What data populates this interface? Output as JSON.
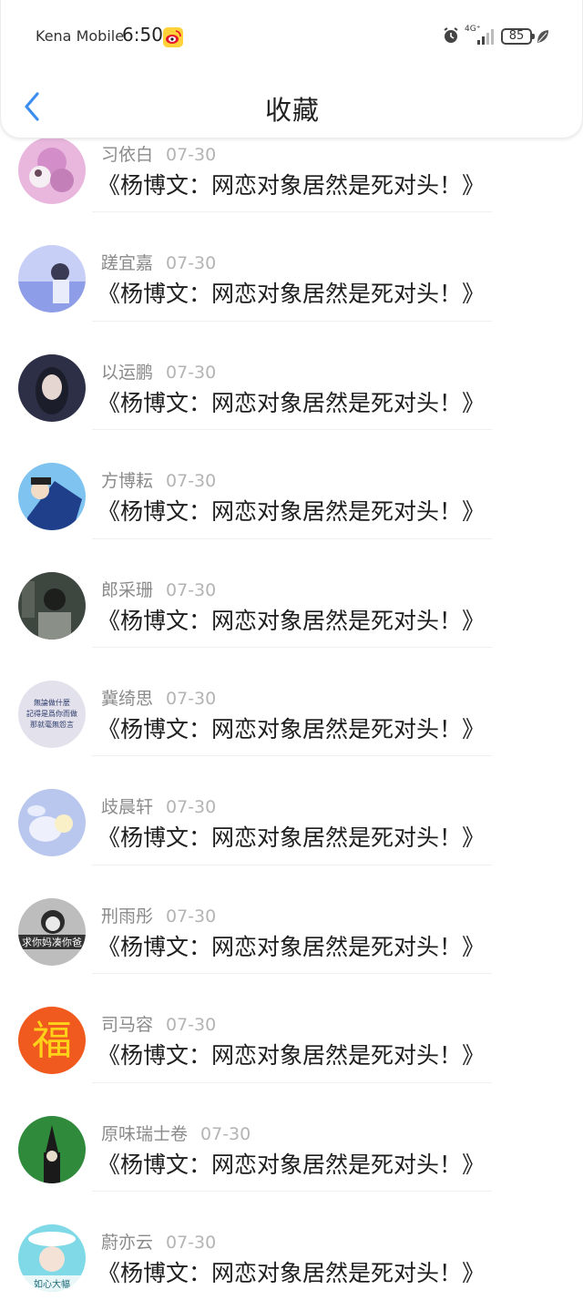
{
  "status_bar": {
    "carrier": "Kena Mobile",
    "time": "6:50",
    "network": "4G⁺",
    "battery": "85",
    "icons": [
      "weibo-icon",
      "alarm-icon",
      "signal-icon",
      "battery-icon",
      "leaf-icon"
    ]
  },
  "header": {
    "title": "收藏",
    "back_icon": "chevron-left-icon",
    "accent_color": "#3d8ef0"
  },
  "items": [
    {
      "name": "习依白",
      "date": "07-30",
      "title": "《杨博文：网恋对象居然是死对头！》"
    },
    {
      "name": "蹉宜嘉",
      "date": "07-30",
      "title": "《杨博文：网恋对象居然是死对头！》"
    },
    {
      "name": "以运鹏",
      "date": "07-30",
      "title": "《杨博文：网恋对象居然是死对头！》"
    },
    {
      "name": "方博耘",
      "date": "07-30",
      "title": "《杨博文：网恋对象居然是死对头！》"
    },
    {
      "name": "郎采珊",
      "date": "07-30",
      "title": "《杨博文：网恋对象居然是死对头！》"
    },
    {
      "name": "冀绮思",
      "date": "07-30",
      "title": "《杨博文：网恋对象居然是死对头！》",
      "avatar_text": [
        "無論做什麼",
        "記得是爲你而做",
        "那就毫無怨言"
      ]
    },
    {
      "name": "歧晨轩",
      "date": "07-30",
      "title": "《杨博文：网恋对象居然是死对头！》"
    },
    {
      "name": "刑雨彤",
      "date": "07-30",
      "title": "《杨博文：网恋对象居然是死对头！》",
      "avatar_text": [
        "求你妈凑你爸"
      ]
    },
    {
      "name": "司马容",
      "date": "07-30",
      "title": "《杨博文：网恋对象居然是死对头！》",
      "avatar_text": [
        "福"
      ]
    },
    {
      "name": "原味瑞士卷",
      "date": "07-30",
      "title": "《杨博文：网恋对象居然是死对头！》"
    },
    {
      "name": "蔚亦云",
      "date": "07-30",
      "title": "《杨博文：网恋对象居然是死对头！》",
      "avatar_text": [
        "如心大幅"
      ]
    }
  ]
}
